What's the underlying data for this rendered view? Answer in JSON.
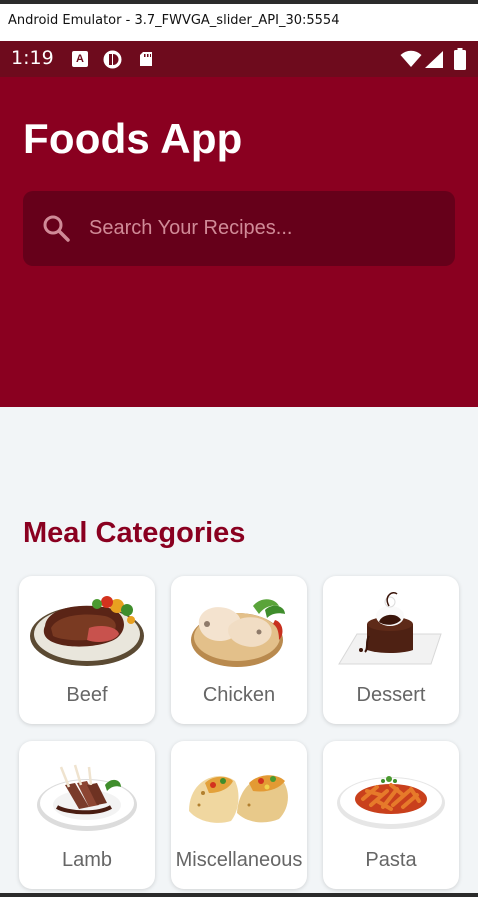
{
  "window": {
    "title": "Android Emulator - 3.7_FWVGA_slider_API_30:5554"
  },
  "status_bar": {
    "time": "1:19",
    "a_icon_letter": "A"
  },
  "header": {
    "title": "Foods App",
    "search_placeholder": "Search Your Recipes..."
  },
  "section": {
    "title": "Meal Categories"
  },
  "categories": [
    {
      "label": "Beef",
      "icon": "beef-image"
    },
    {
      "label": "Chicken",
      "icon": "chicken-image"
    },
    {
      "label": "Dessert",
      "icon": "dessert-image"
    },
    {
      "label": "Lamb",
      "icon": "lamb-image"
    },
    {
      "label": "Miscellaneous",
      "icon": "taco-image"
    },
    {
      "label": "Pasta",
      "icon": "pasta-image"
    }
  ],
  "colors": {
    "primary": "#8a0020",
    "search_bg": "#66001a",
    "status_bar": "#6e0b1d",
    "background": "#f2f5f7"
  }
}
